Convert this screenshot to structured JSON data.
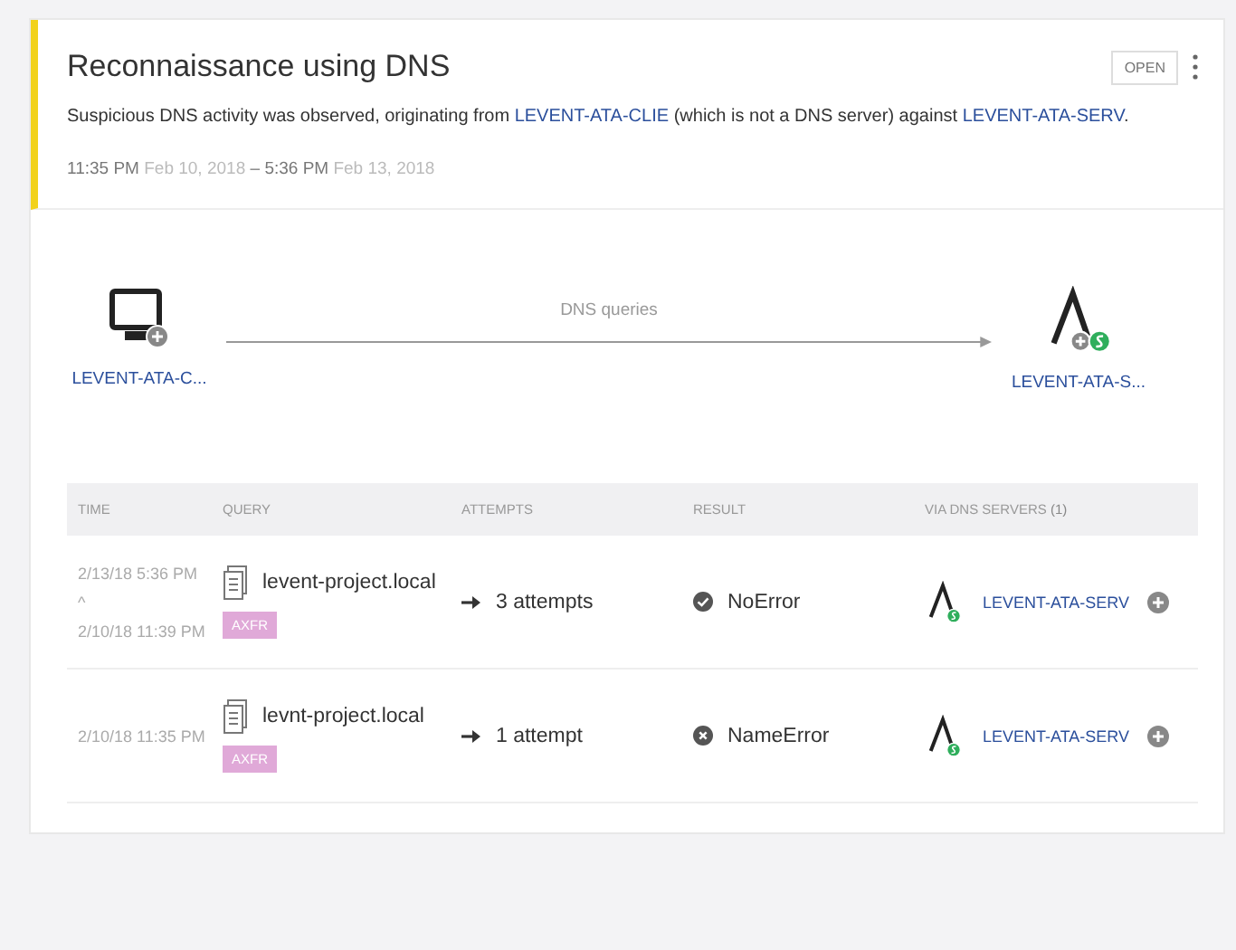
{
  "alert": {
    "title": "Reconnaissance using DNS",
    "status_button": "OPEN",
    "description": {
      "before": "Suspicious DNS activity was observed, originating from",
      "source": "LEVENT-ATA-CLIE",
      "middle": "(which is not a DNS server) against",
      "target": "LEVENT-ATA-SERV",
      "after": "."
    },
    "start_time": "11:35 PM",
    "start_date": "Feb 10, 2018",
    "separator": "–",
    "end_time": "5:36 PM",
    "end_date": "Feb 13, 2018"
  },
  "diagram": {
    "source": "LEVENT-ATA-C...",
    "edge_label": "DNS queries",
    "target": "LEVENT-ATA-S..."
  },
  "table": {
    "columns": [
      "TIME",
      "QUERY",
      "ATTEMPTS",
      "RESULT",
      "VIA DNS SERVERS"
    ],
    "server_count": "(1)",
    "rows": [
      {
        "time": [
          "2/13/18 5:36 PM",
          "^",
          "2/10/18 11:39 PM"
        ],
        "query": "levent-project.local",
        "tag": "AXFR",
        "attempts": "3 attempts",
        "result": "NoError",
        "kind": "ok",
        "server": "LEVENT-ATA-SERV"
      },
      {
        "time": [
          "2/10/18 11:35 PM"
        ],
        "query": "levnt-project.local",
        "tag": "AXFR",
        "attempts": "1 attempt",
        "result": "NameError",
        "kind": "error",
        "server": "LEVENT-ATA-SERV"
      }
    ]
  }
}
